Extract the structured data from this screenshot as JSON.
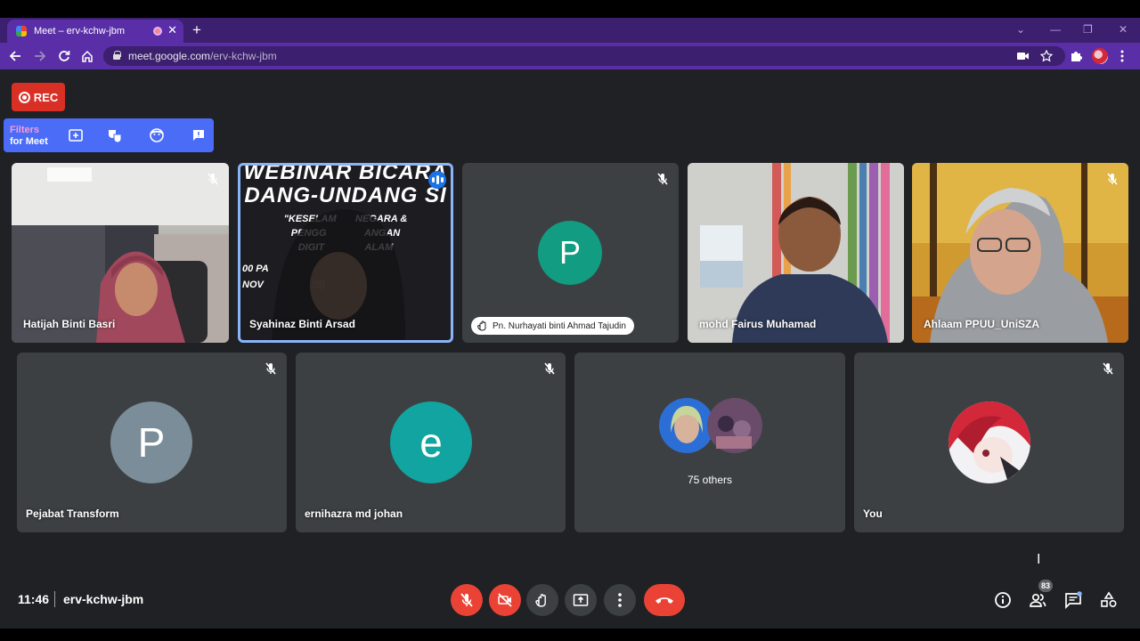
{
  "browser": {
    "tab_title": "Meet – erv-kchw-jbm",
    "tab_close": "✕",
    "new_tab": "+",
    "url_host": "meet.google.com",
    "url_path": "/erv-kchw-jbm",
    "window_controls": [
      "⌄",
      "—",
      "❐",
      "✕"
    ]
  },
  "rec_badge": {
    "label": "REC",
    "color": "#d93025"
  },
  "filters_bar": {
    "label_top": "Filters",
    "label_bottom": "for Meet",
    "icons": [
      "add-photo-icon",
      "masks-icon",
      "face-icon",
      "feedback-icon"
    ]
  },
  "participants": {
    "row1": [
      {
        "name": "Hatijah Binti Basri",
        "type": "video"
      },
      {
        "name": "Syahinaz Binti Arsad",
        "type": "video",
        "speaking": true
      },
      {
        "name": "Pn. Nurhayati binti Ahmad Tajudin",
        "type": "avatar",
        "avatar_letter": "P",
        "avatar_color": "#129c82",
        "hand_raised": true
      },
      {
        "name": "mohd Fairus Muhamad",
        "type": "video"
      },
      {
        "name": "Ahlaam PPUU_UniSZA",
        "type": "video"
      }
    ],
    "row2": [
      {
        "name": "Pejabat Transform",
        "type": "avatar",
        "avatar_letter": "P",
        "avatar_color": "#7b8d99"
      },
      {
        "name": "ernihazra md johan",
        "type": "avatar",
        "avatar_letter": "e",
        "avatar_color": "#12a4a0"
      },
      {
        "name": "75 others",
        "type": "others"
      },
      {
        "name": "You",
        "type": "self"
      }
    ]
  },
  "webinar_slide": {
    "line1": "WEBINAR BICARA",
    "line2": "DANG-UNDANG SI",
    "line3": "\"KESELAM       NEGARA &",
    "line4": "PENGG              ANGAN",
    "line5": "DIGIT               ALAM",
    "line6": "00 PA",
    "line7": "NOV                  IS)"
  },
  "bottom_bar": {
    "time": "11:46",
    "meeting_code": "erv-kchw-jbm",
    "people_count": "83",
    "controls": [
      "mic-off-icon",
      "camera-off-icon",
      "raise-hand-icon",
      "present-screen-icon",
      "more-options-icon",
      "hang-up-icon"
    ],
    "right_icons": [
      "info-icon",
      "people-icon",
      "chat-icon",
      "activities-icon"
    ]
  },
  "colors": {
    "background": "#202124",
    "tile": "#3c4043",
    "accent_red": "#ea4335",
    "speaking_border": "#8ab4f8",
    "browser_purple": "#5a2ea6"
  }
}
